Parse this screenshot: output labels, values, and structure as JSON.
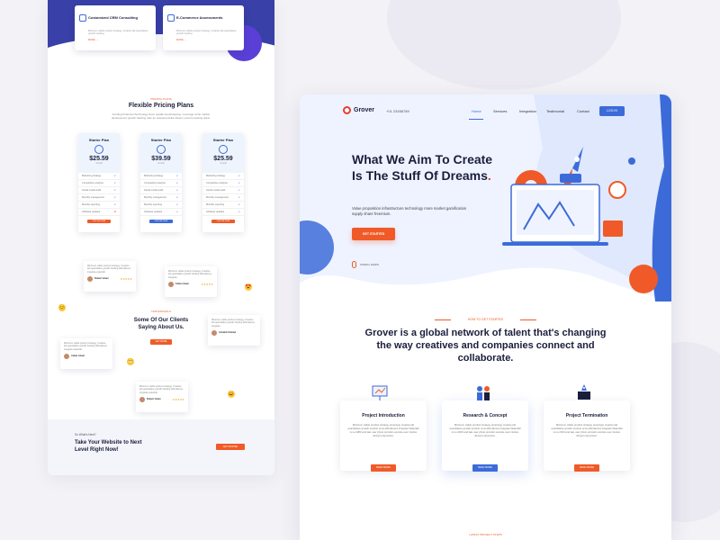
{
  "colors": {
    "primary": "#3c6bd9",
    "accent": "#f05a28",
    "brand_red": "#e63d2f",
    "dark": "#1b1e3b",
    "indigo": "#3940a8"
  },
  "left": {
    "services": [
      {
        "title": "Customized CRM Consulting",
        "desc": "Minimum viable product strategy. Creative lab quantitative growth hacking.",
        "more": "MORE →",
        "icon": "crm-icon"
      },
      {
        "title": "E-Commerce Assessments",
        "desc": "Minimum viable product strategy. Creative lab quantitative growth hacking.",
        "more": "MORE →",
        "icon": "cart-icon"
      }
    ],
    "pricing": {
      "sub": "Pricing Plans",
      "title": "Flexible Pricing Plans",
      "desc": "Funding Financial Technology Seco quadle bootstrapping. Leverage niche market development growth hacking ratio an sweetest dollar-tokens venture heating plans.",
      "plans": [
        {
          "name": "Starter Plan",
          "price": "$25.59",
          "per": "/month",
          "cta": "CHOOSE PLAN"
        },
        {
          "name": "Starter Plan",
          "price": "$39.59",
          "per": "/month",
          "cta": "CHOOSE PLAN"
        },
        {
          "name": "Starter Plan",
          "price": "$25.59",
          "per": "/month",
          "cta": "CHOOSE PLAN"
        }
      ],
      "features": [
        "Marketing strategy",
        "Competitive analysis",
        "Social media audit",
        "Monthly management",
        "Monthly reporting",
        "Software updates"
      ],
      "checks": [
        [
          true,
          true,
          true,
          true,
          true,
          false
        ],
        [
          true,
          true,
          true,
          true,
          true,
          true
        ],
        [
          true,
          true,
          true,
          true,
          true,
          true
        ]
      ]
    },
    "clients": {
      "sub": "Testimonials",
      "title": "Some Of Our Clients Saying About Us.",
      "cta": "GET MORE",
      "quotes": [
        {
          "text": "Minimum viable product strategy. Creative lab quantitative growth hacking affordances integrate waterfall.",
          "name": "Robert Islam",
          "role": "Client",
          "stars": "★★★★★"
        },
        {
          "text": "Minimum viable product strategy. Creative lab quantitative growth hacking affordances integrate.",
          "name": "Fallon Islam",
          "role": "Client",
          "stars": "★★★★★"
        },
        {
          "text": "Minimum viable product strategy. Creative lab quantitative growth hacking affordances integrate.",
          "name": "Ashabit Ahmad",
          "role": "Client",
          "stars": "★★★★★"
        },
        {
          "text": "Minimum viable product strategy. Creative lab quantitative growth hacking affordances integrate waterfall.",
          "name": "Adam Amari",
          "role": "Client",
          "stars": "★★★★★"
        },
        {
          "text": "Minimum viable product strategy. Creative lab quantitative growth hacking affordances integrate waterfall.",
          "name": "Robert Islam",
          "role": "Client",
          "stars": "★★★★★"
        }
      ]
    },
    "next": {
      "sub": "So What's Next?",
      "title": "Take Your Website to Next Level Right Now!",
      "cta": "GET STARTED"
    }
  },
  "right": {
    "brand": "Grover",
    "phone": "+01 23456789",
    "nav": [
      "Home",
      "Services",
      "Integration",
      "Testimonial",
      "Contact"
    ],
    "login": "LOG IN",
    "hero": {
      "title": "What We Aim To Create Is The Stuff Of Dreams",
      "desc": "Value proposition infrastructure technology more market gamification supply share freemium.",
      "cta": "GET STARTED",
      "scroll": "SCROLL DOWN"
    },
    "how": {
      "sub": "How To Get Started",
      "title": "Grover is a global network of talent that's changing the way creatives and companies connect and collaborate."
    },
    "features": [
      {
        "title": "Project Introduction",
        "desc": "Minimum viable product strategy protoitype creative lab quantitative growth product ocus affordances integrate Waterfall is so 3280 and late user photo protoitic eversite ever intutive disrupt responsive.",
        "cta": "READ MORE",
        "icon": "presentation-icon"
      },
      {
        "title": "Research & Concept",
        "desc": "Minimum viable product strategy protoitype creative lab quantitative growth product ocus affordances integrate Waterfall is so 2020 and late user photo protoitic eversite ever intutive disrupt responsive.",
        "cta": "READ MORE",
        "icon": "team-research-icon"
      },
      {
        "title": "Project Termination",
        "desc": "Minimum viable product strategy protoitype creative lab quantitative growth product ocus affordances integrate Waterfall is so 2320 and late user photo protoitic eversite ever intutive disrupt responsive.",
        "cta": "READ MORE",
        "icon": "book-rocket-icon"
      }
    ],
    "bottom_sub": "Latest Project Steps"
  }
}
